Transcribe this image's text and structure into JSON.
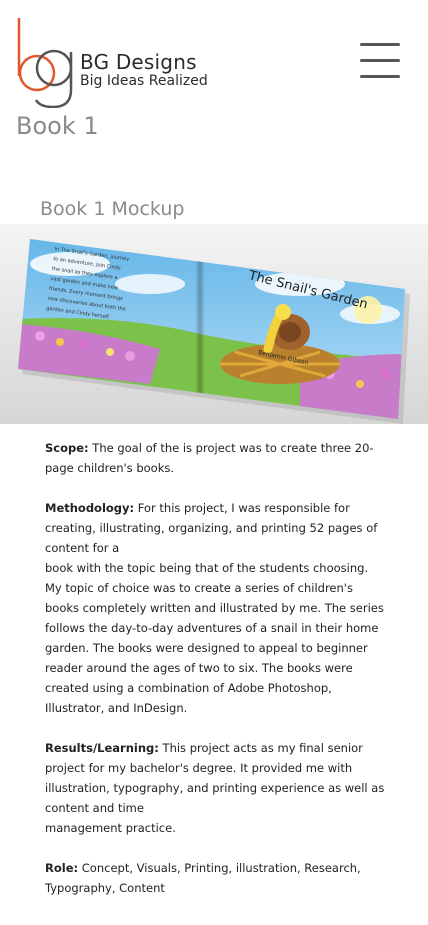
{
  "brand": {
    "logo_letters": "bg",
    "name": "BG Designs",
    "tagline": "Big Ideas Realized"
  },
  "menu": {
    "icon": "hamburger-icon"
  },
  "page": {
    "title": "Book 1",
    "section_title": "Book 1 Mockup"
  },
  "mockup": {
    "book_title": "The Snail's Garden",
    "author": "Benjamin Gibson",
    "back_cover_text": "In The Snail's Garden, journey to an adventure. Join Cindy the snail as they explore a vast garden and make new friends. Every moment brings new discoveries about both the garden and Cindy herself."
  },
  "content": {
    "scope_label": "Scope:",
    "scope_text": " The goal of the is project was to create three 20-page children's books.",
    "methodology_label": "Methodology:",
    "methodology_text_1": " For this project, I was responsible for creating, illustrating, organizing, and printing 52 pages of content for a",
    "methodology_text_2": "book with the topic being that of the students choosing. My topic of choice was to create a series of children's books completely written and illustrated by me. The series follows the day-to-day adventures of a snail in their home garden. The books were designed to appeal to beginner reader around the ages of two to six. The books were created using a combination of Adobe  Photoshop,  Illustrator, and InDesign.",
    "results_label": "Results/Learning:",
    "results_text_1": " This project acts as my final senior project for my bachelor's degree. It provided me with illustration, typography, and printing experience as well as content and time",
    "results_text_2": "management practice.",
    "role_label": "Role:",
    "role_text": " Concept, Visuals, Printing, illustration, Research, Typography, Content"
  },
  "colors": {
    "title_gray": "#8a8a8a",
    "logo_orange": "#e2572c",
    "logo_gray": "#555555"
  }
}
